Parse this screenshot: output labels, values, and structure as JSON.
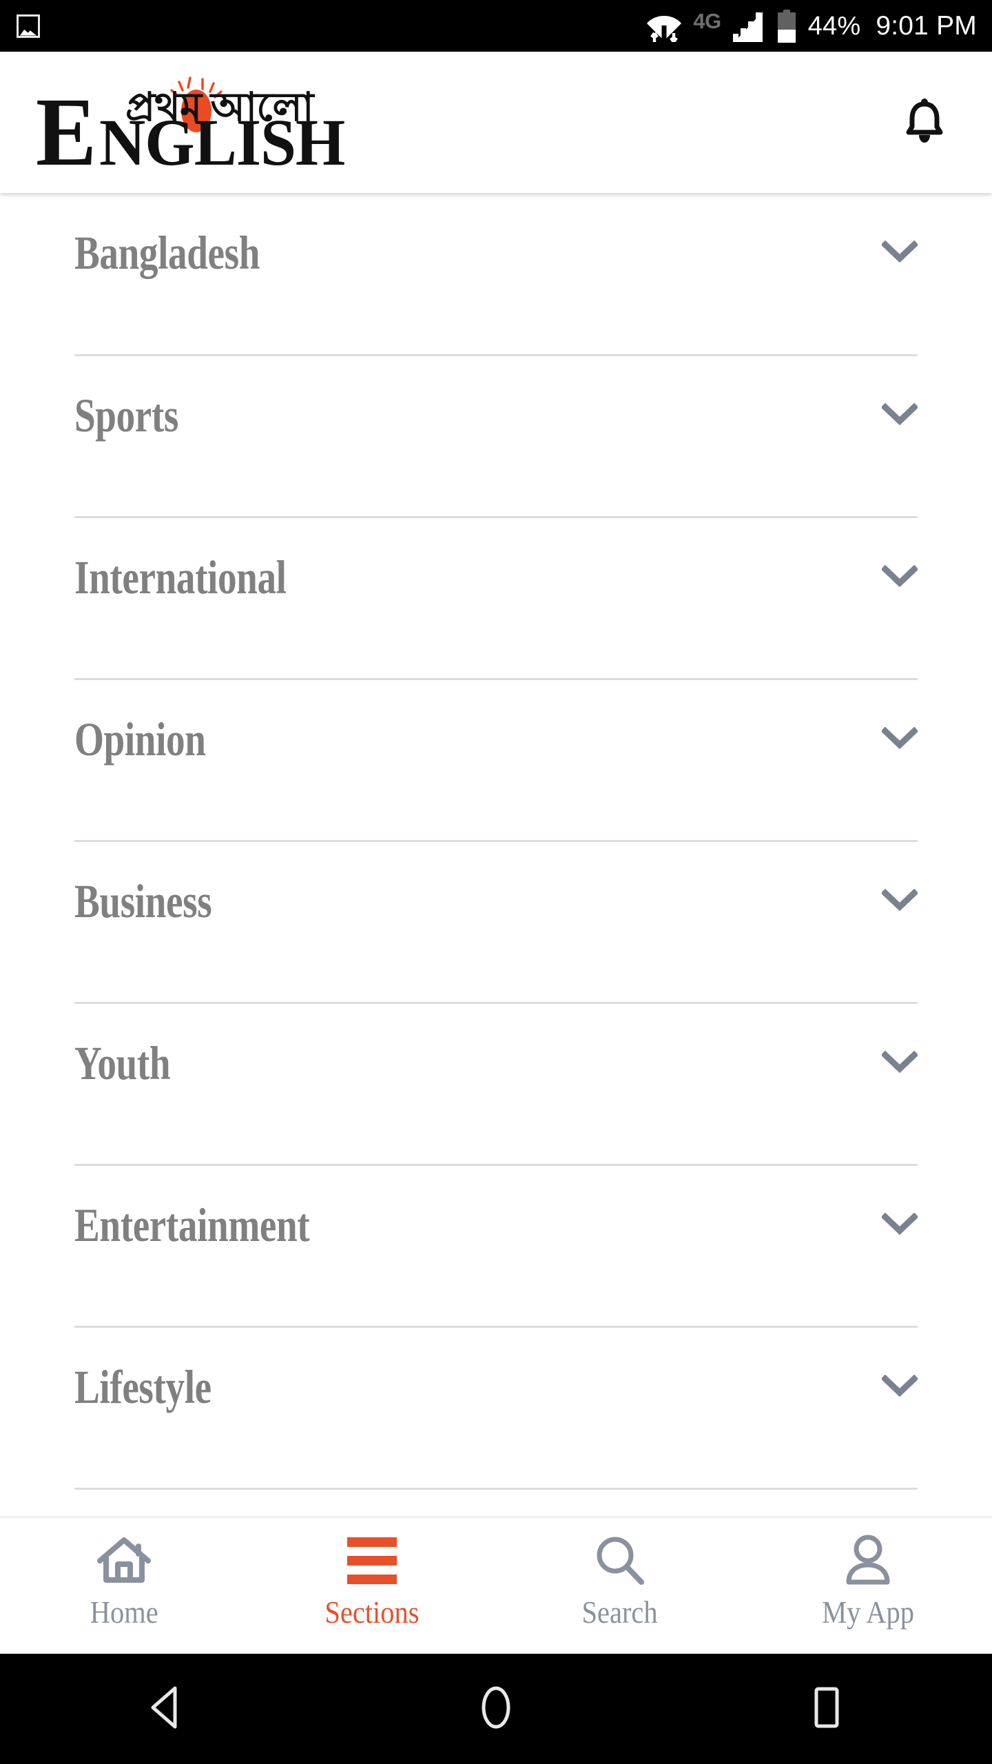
{
  "status_bar": {
    "photo_icon": "image-icon",
    "wifi_icon": "wifi-updown-icon",
    "network_type": "4G",
    "signal_icon": "cellular-signal-icon",
    "battery_icon": "battery-icon",
    "battery_percent": "44%",
    "clock": "9:01 PM"
  },
  "header": {
    "logo_bengali": "প্রথম আলো",
    "logo_initial": "E",
    "logo_rest": "NGLISH",
    "logo_full": "Prothom Alo English",
    "notification_icon": "bell-icon"
  },
  "sections": {
    "items": [
      {
        "label": "Bangladesh",
        "chevron": "chevron-down-icon",
        "expanded": false
      },
      {
        "label": "Sports",
        "chevron": "chevron-down-icon",
        "expanded": false
      },
      {
        "label": "International",
        "chevron": "chevron-down-icon",
        "expanded": false
      },
      {
        "label": "Opinion",
        "chevron": "chevron-down-icon",
        "expanded": false
      },
      {
        "label": "Business",
        "chevron": "chevron-down-icon",
        "expanded": false
      },
      {
        "label": "Youth",
        "chevron": "chevron-down-icon",
        "expanded": false
      },
      {
        "label": "Entertainment",
        "chevron": "chevron-down-icon",
        "expanded": false
      },
      {
        "label": "Lifestyle",
        "chevron": "chevron-down-icon",
        "expanded": false
      }
    ]
  },
  "bottom_nav": {
    "items": [
      {
        "label": "Home",
        "icon": "house-icon",
        "active": false
      },
      {
        "label": "Sections",
        "icon": "hamburger-icon",
        "active": true
      },
      {
        "label": "Search",
        "icon": "search-icon",
        "active": false
      },
      {
        "label": "My App",
        "icon": "person-icon",
        "active": false
      }
    ]
  },
  "android_nav": {
    "back": "back-triangle-icon",
    "home": "home-circle-icon",
    "recents": "recents-square-icon"
  },
  "colors": {
    "accent_orange": "#E8502A",
    "logo_sun": "#EB4B23",
    "label_gray": "#808080",
    "icon_gray": "#8a919e",
    "chevron_gray": "#7a818f",
    "divider": "#dcdcdc",
    "status_bar_bg": "#000000"
  }
}
